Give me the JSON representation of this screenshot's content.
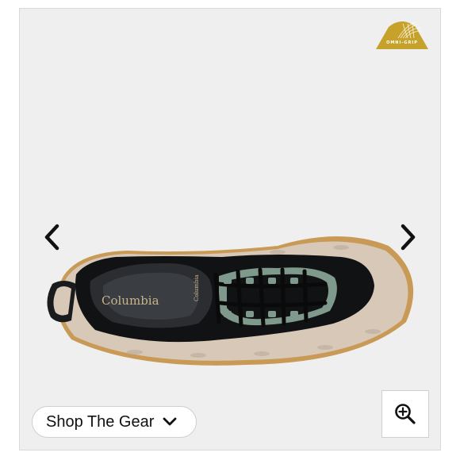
{
  "product_image": {
    "badge_text": "OMNI-GRIP",
    "brand_logo_text": "Columbia",
    "tongue_logo_text": "Columbia"
  },
  "navigation": {
    "prev_icon": "chevron-left-icon",
    "next_icon": "chevron-right-icon"
  },
  "shop_button": {
    "label": "Shop The Gear",
    "icon": "chevron-down-icon"
  },
  "zoom_button": {
    "icon": "zoom-in-icon"
  },
  "colors": {
    "background": "#efefef",
    "badge": "#c7a22a",
    "upper": "#111214",
    "accent": "#7f9a8c",
    "sole": "#d7c8b8",
    "outsole_edge": "#c99a55"
  }
}
